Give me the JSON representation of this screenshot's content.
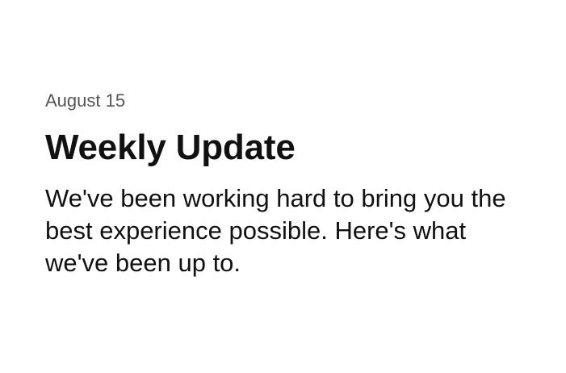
{
  "post": {
    "date": "August 15",
    "title": "Weekly Update",
    "body": "We've been working hard to bring you the best experience possible. Here's what we've been up to."
  },
  "colors": {
    "background": "#ffffff",
    "date_text": "#555555",
    "primary_text": "#111111"
  }
}
